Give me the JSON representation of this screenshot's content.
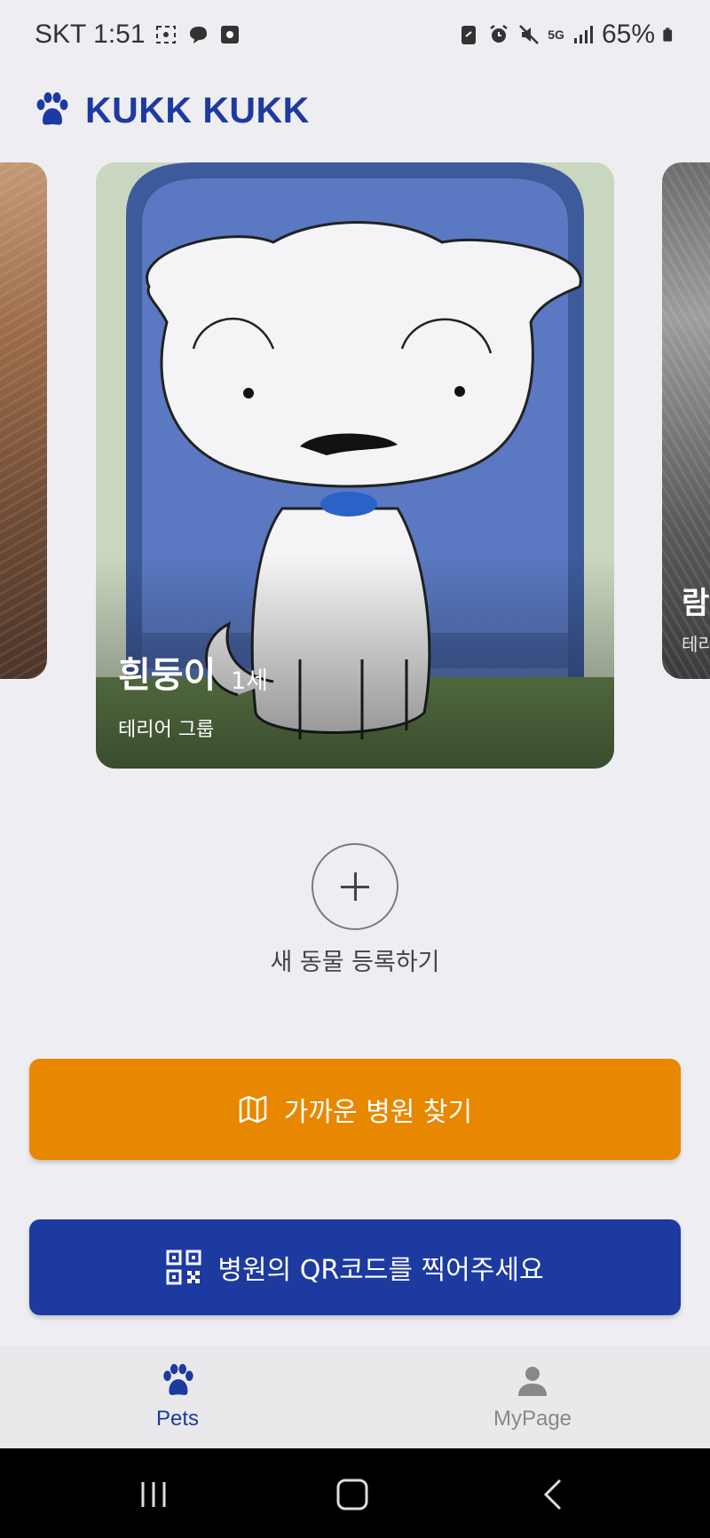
{
  "status_bar": {
    "carrier_time": "SKT 1:51",
    "battery": "65%",
    "network": "5G"
  },
  "header": {
    "title": "KUKK KUKK",
    "logo_icon": "paw-icon"
  },
  "carousel": {
    "main_card": {
      "name": "흰둥이",
      "age": "1세",
      "breed": "테리어 그룹"
    },
    "right_card": {
      "name": "람",
      "breed": "테리"
    }
  },
  "add_pet": {
    "label": "새 동물 등록하기"
  },
  "actions": {
    "hospital_label": "가까운 병원 찾기",
    "qr_label": "병원의 QR코드를 찍어주세요"
  },
  "bottom_nav": {
    "pets_label": "Pets",
    "mypage_label": "MyPage",
    "active": "Pets"
  },
  "colors": {
    "brand": "#1d3aa0",
    "accent": "#e78800",
    "background": "#eeeef2"
  }
}
